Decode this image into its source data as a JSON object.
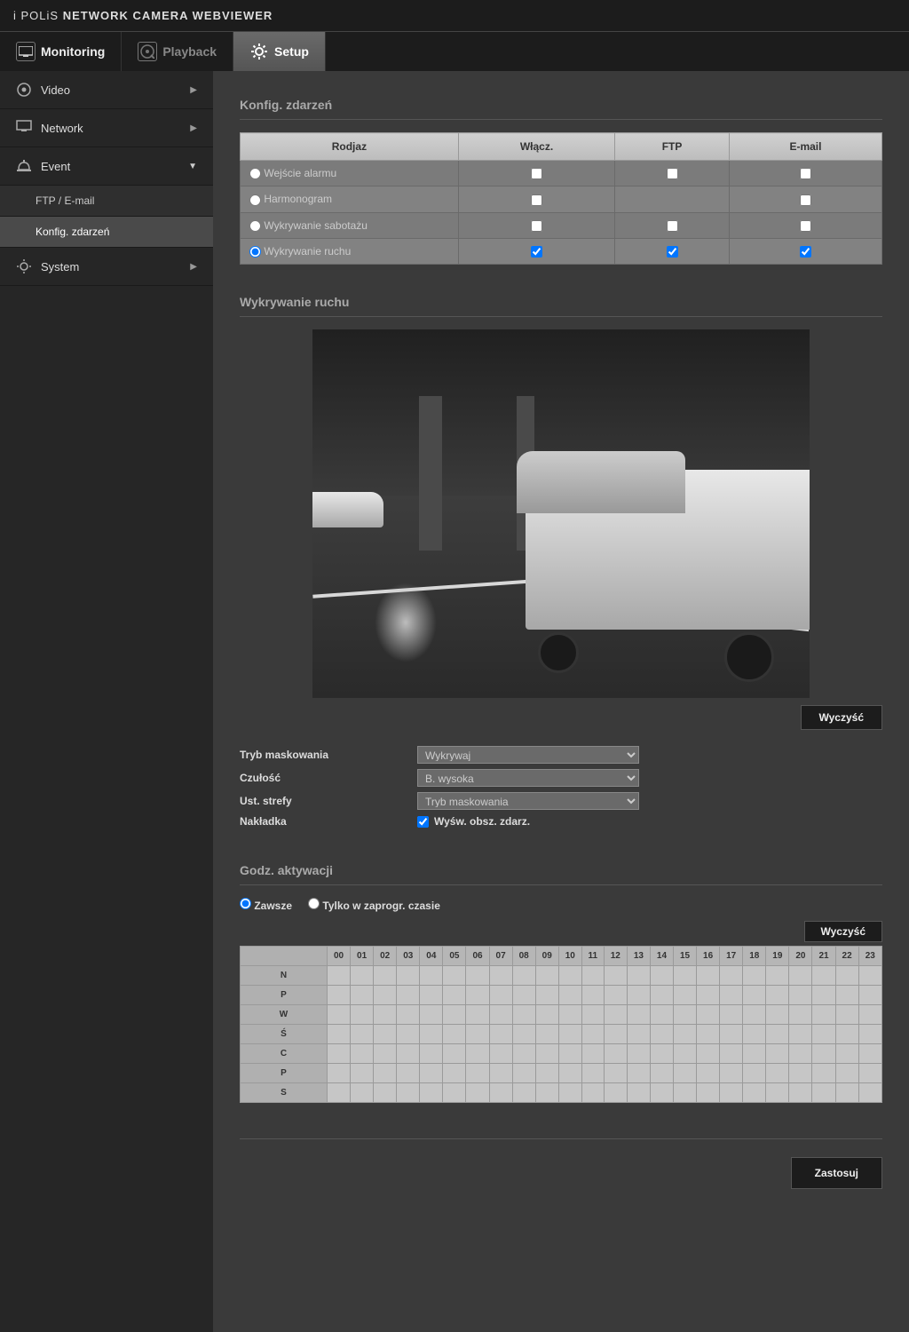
{
  "header": {
    "brand": "i POLiS",
    "title": "NETWORK CAMERA WEBVIEWER"
  },
  "tabs": {
    "monitoring": "Monitoring",
    "playback": "Playback",
    "setup": "Setup"
  },
  "sidebar": {
    "video": "Video",
    "network": "Network",
    "event": "Event",
    "event_sub": {
      "ftp": "FTP / E-mail",
      "konfig": "Konfig. zdarzeń"
    },
    "system": "System"
  },
  "sections": {
    "konfig_title": "Konfig. zdarzeń",
    "motion_title": "Wykrywanie ruchu",
    "activation_title": "Godz. aktywacji"
  },
  "cfg_table": {
    "headers": {
      "type": "Rodjaz",
      "enable": "Włącz.",
      "ftp": "FTP",
      "email": "E-mail"
    },
    "rows": [
      {
        "label": "Wejście alarmu",
        "selected": false,
        "enable": false,
        "ftp": false,
        "email": false,
        "ftp_na": false
      },
      {
        "label": "Harmonogram",
        "selected": false,
        "enable": false,
        "ftp": false,
        "email": false,
        "ftp_na": true
      },
      {
        "label": "Wykrywanie sabotażu",
        "selected": false,
        "enable": false,
        "ftp": false,
        "email": false,
        "ftp_na": false
      },
      {
        "label": "Wykrywanie ruchu",
        "selected": true,
        "enable": true,
        "ftp": true,
        "email": true,
        "ftp_na": false
      }
    ]
  },
  "buttons": {
    "clear": "Wyczyść",
    "clear2": "Wyczyść",
    "apply": "Zastosuj"
  },
  "motion_form": {
    "mask_mode_label": "Tryb maskowania",
    "mask_mode_value": "Wykrywaj",
    "sensitivity_label": "Czułość",
    "sensitivity_value": "B. wysoka",
    "zone_label": "Ust. strefy",
    "zone_value": "Tryb maskowania",
    "overlay_label": "Nakładka",
    "overlay_checkbox_label": "Wyśw. obsz. zdarz."
  },
  "activation": {
    "always": "Zawsze",
    "scheduled": "Tylko w zaprogr. czasie"
  },
  "schedule": {
    "hours": [
      "00",
      "01",
      "02",
      "03",
      "04",
      "05",
      "06",
      "07",
      "08",
      "09",
      "10",
      "11",
      "12",
      "13",
      "14",
      "15",
      "16",
      "17",
      "18",
      "19",
      "20",
      "21",
      "22",
      "23"
    ],
    "days": [
      "N",
      "P",
      "W",
      "Ś",
      "C",
      "P",
      "S"
    ]
  }
}
